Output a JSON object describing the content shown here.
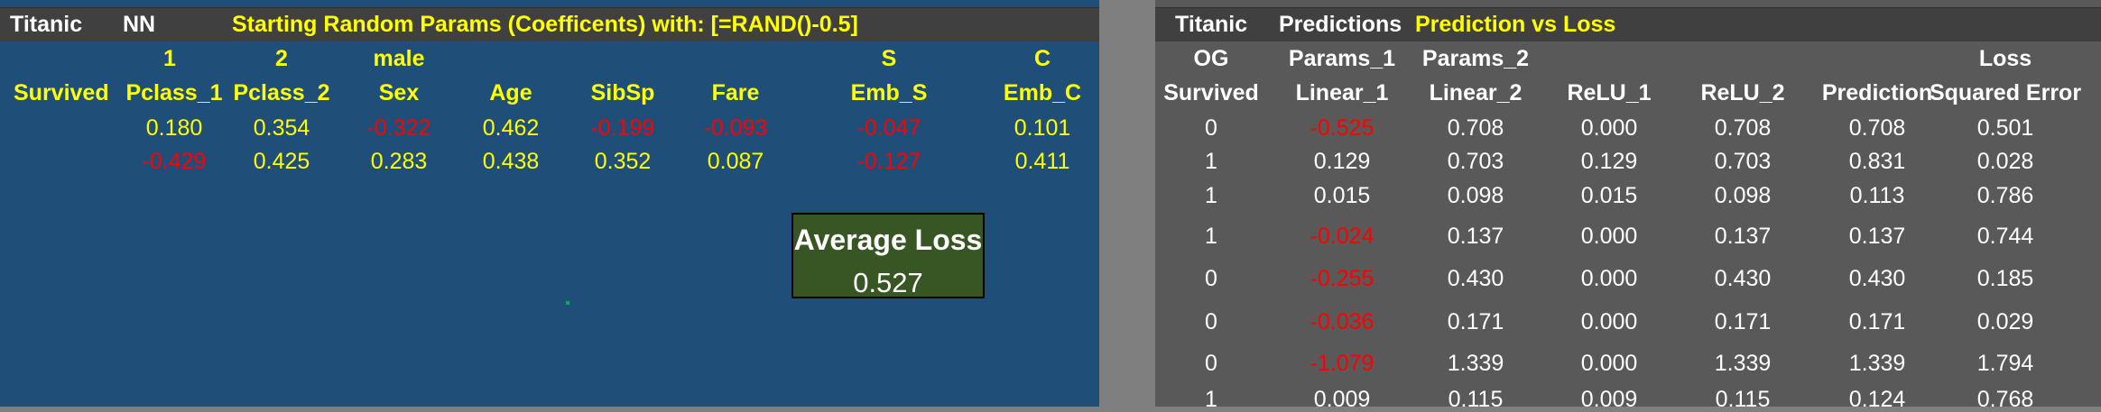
{
  "left": {
    "title_row": {
      "sheet": "Titanic",
      "model": "NN",
      "heading": "Starting Random Params (Coefficents) with: [=RAND()-0.5]"
    },
    "group_row": [
      "1",
      "2",
      "male",
      "S",
      "C"
    ],
    "header_row": [
      "Survived",
      "Pclass_1",
      "Pclass_2",
      "Sex",
      "Age",
      "SibSp",
      "Fare",
      "Emb_S",
      "Emb_C"
    ],
    "param_rows": [
      [
        "0.180",
        "0.354",
        "-0.322",
        "0.462",
        "-0.199",
        "-0.093",
        "-0.047",
        "0.101"
      ],
      [
        "-0.429",
        "0.425",
        "0.283",
        "0.438",
        "0.352",
        "0.087",
        "-0.127",
        "0.411"
      ]
    ],
    "average_loss": {
      "label": "Average Loss",
      "value": "0.527"
    }
  },
  "right": {
    "title_row": {
      "sheet": "Titanic",
      "section": "Predictions",
      "heading": "Prediction vs Loss"
    },
    "group_row": [
      "OG",
      "Params_1",
      "Params_2",
      "Loss"
    ],
    "header_row": [
      "Survived",
      "Linear_1",
      "Linear_2",
      "ReLU_1",
      "ReLU_2",
      "Prediction",
      "Squared Error"
    ],
    "rows": [
      [
        "0",
        "-0.525",
        "0.708",
        "0.000",
        "0.708",
        "0.708",
        "0.501"
      ],
      [
        "1",
        "0.129",
        "0.703",
        "0.129",
        "0.703",
        "0.831",
        "0.028"
      ],
      [
        "1",
        "0.015",
        "0.098",
        "0.015",
        "0.098",
        "0.113",
        "0.786"
      ],
      [
        "1",
        "-0.024",
        "0.137",
        "0.000",
        "0.137",
        "0.137",
        "0.744"
      ],
      [
        "0",
        "-0.255",
        "0.430",
        "0.000",
        "0.430",
        "0.430",
        "0.185"
      ],
      [
        "0",
        "-0.036",
        "0.171",
        "0.000",
        "0.171",
        "0.171",
        "0.029"
      ],
      [
        "0",
        "-1.079",
        "1.339",
        "0.000",
        "1.339",
        "1.339",
        "1.794"
      ],
      [
        "1",
        "0.009",
        "0.115",
        "0.009",
        "0.115",
        "0.124",
        "0.768"
      ]
    ]
  },
  "colors": {
    "left_bg": "#1f4e78",
    "right_bg": "#595959",
    "title_bar": "#404040",
    "positive_value": "#ffff00",
    "negative_value": "#ff0000",
    "loss_box": "#375623"
  }
}
